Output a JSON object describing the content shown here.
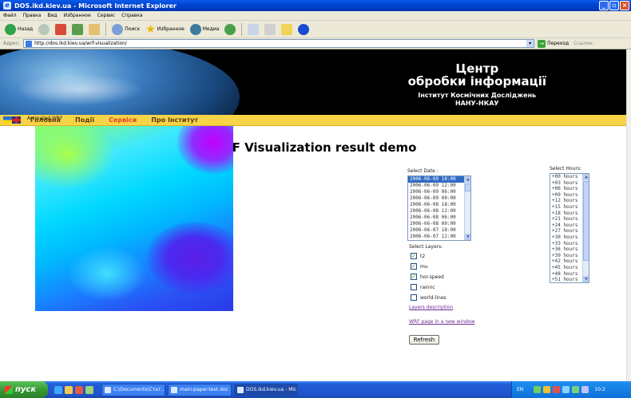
{
  "window": {
    "title": "DOS.ikd.kiev.ua - Microsoft Internet Explorer"
  },
  "menu": [
    "Файл",
    "Правка",
    "Вид",
    "Избранное",
    "Сервис",
    "Справка"
  ],
  "toolbar": {
    "back_label": "Назад",
    "search_label": "Поиск",
    "favorites_label": "Избранное",
    "media_label": "Медиа"
  },
  "address": {
    "label": "Адрес:",
    "url": "http://dos.ikd.kiev.ua/wrf-visualization/",
    "go_label": "Переход",
    "links_label": "Ссылки"
  },
  "banner": {
    "line1": "Центр",
    "line2": "обробки інформації",
    "line3": "Інститут Космічних Досліджень",
    "line4": "НАНУ-НКАУ"
  },
  "nav": {
    "items": [
      "Головна",
      "Події",
      "Сервіси",
      "Про Інститут"
    ],
    "active_index": 2
  },
  "page": {
    "title": "WRF Visualization result demo",
    "animated_label": "Animated WRF",
    "date_label": "Select Date :",
    "hours_label": "Select Hours:",
    "layers_label": "Select Layers:",
    "dates": [
      "2006-06-09 18:00",
      "2006-06-09 12:00",
      "2006-06-09 06:00",
      "2006-06-09 00:00",
      "2006-06-08 18:00",
      "2006-06-08 12:00",
      "2006-06-08 06:00",
      "2006-06-08 00:00",
      "2006-06-07 18:00",
      "2006-06-07 12:00"
    ],
    "selected_date_index": 0,
    "hours": [
      "+00 hours",
      "+03 hours",
      "+06 hours",
      "+09 hours",
      "+12 hours",
      "+15 hours",
      "+18 hours",
      "+21 hours",
      "+24 hours",
      "+27 hours",
      "+30 hours",
      "+33 hours",
      "+36 hours",
      "+39 hours",
      "+42 hours",
      "+45 hours",
      "+48 hours",
      "+51 hours"
    ],
    "layers": [
      {
        "label": "t2",
        "checked": true
      },
      {
        "label": "mu",
        "checked": true
      },
      {
        "label": "hor-speed",
        "checked": true
      },
      {
        "label": "rainnc",
        "checked": false
      },
      {
        "label": "world-lines",
        "checked": false
      }
    ],
    "layers_description_link": "Layers description",
    "wrf_page_link": "WRF page in a new window",
    "refresh_label": "Refresh"
  },
  "taskbar": {
    "start_label": "пуск",
    "tasks": [
      {
        "label": "C:\\Documents\\Стат...",
        "active": false
      },
      {
        "label": "main-paper-text.doc ...",
        "active": false
      },
      {
        "label": "DOS.ikd.kiev.ua - Mic...",
        "active": true
      }
    ],
    "lang": "EN",
    "clock": "10:2"
  },
  "colors": {
    "titlebar": "#0046d5",
    "nav_bg": "#f6d347",
    "nav_active": "#e0412a",
    "nav_text": "#5a3a12",
    "link": "#6a2c8f"
  }
}
